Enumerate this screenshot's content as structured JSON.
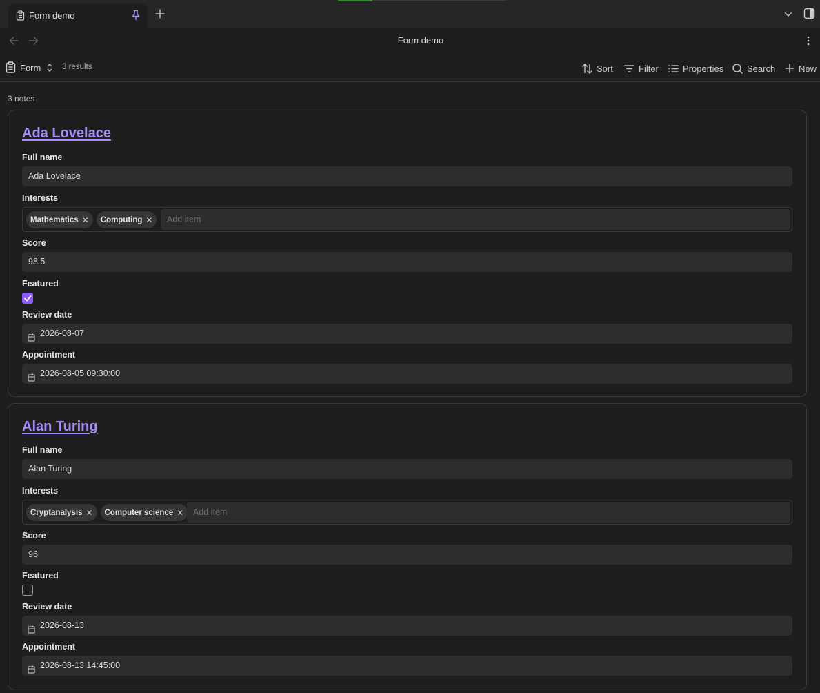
{
  "tab": {
    "title": "Form demo"
  },
  "nav": {
    "title": "Form demo"
  },
  "toolbar": {
    "view_name": "Form",
    "results": "3 results",
    "sort": "Sort",
    "filter": "Filter",
    "properties": "Properties",
    "search": "Search",
    "new": "New"
  },
  "count": "3 notes",
  "labels": {
    "full_name": "Full name",
    "interests": "Interests",
    "score": "Score",
    "featured": "Featured",
    "review_date": "Review date",
    "appointment": "Appointment",
    "add_item": "Add item"
  },
  "notes": [
    {
      "title": "Ada Lovelace",
      "full_name": "Ada Lovelace",
      "interests": [
        "Mathematics",
        "Computing"
      ],
      "score": "98.5",
      "featured": true,
      "review_date": "2026-08-07",
      "appointment": "2026-08-05 09:30:00"
    },
    {
      "title": "Alan Turing",
      "full_name": "Alan Turing",
      "interests": [
        "Cryptanalysis",
        "Computer science"
      ],
      "score": "96",
      "featured": false,
      "review_date": "2026-08-13",
      "appointment": "2026-08-13 14:45:00"
    }
  ],
  "colors": {
    "accent": "#8b5cf6",
    "link": "#a88bfa",
    "background": "#1e1e1e"
  }
}
